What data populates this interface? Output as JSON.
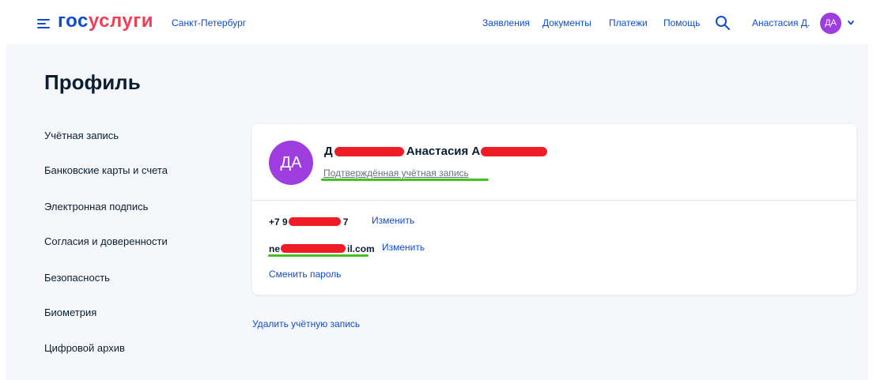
{
  "header": {
    "logo_part1": "гос",
    "logo_part2": "услуги",
    "city": "Санкт-Петербург",
    "nav": [
      "Заявления",
      "Документы",
      "Платежи",
      "Помощь"
    ],
    "user_name": "Анастасия Д.",
    "avatar_initials": "ДА",
    "icons": [
      "menu-icon",
      "search-icon",
      "chevron-down-icon"
    ]
  },
  "page": {
    "title": "Профиль"
  },
  "sidebar": {
    "items": [
      {
        "label": "Учётная запись"
      },
      {
        "label": "Банковские карты и счета"
      },
      {
        "label": "Электронная подпись"
      },
      {
        "label": "Согласия и доверенности"
      },
      {
        "label": "Безопасность"
      },
      {
        "label": "Биометрия"
      },
      {
        "label": "Цифровой архив"
      }
    ]
  },
  "profile": {
    "avatar_initials": "ДА",
    "name_prefix": "Д",
    "name_middle": "Анастасия А",
    "status": "Подтверждённая учётная запись",
    "phone_prefix": "+7 9",
    "phone_suffix": "7",
    "email_prefix": "ne",
    "email_suffix": "il.com",
    "change_label": "Изменить",
    "change_password": "Сменить пароль"
  },
  "delete_account": "Удалить учётную запись",
  "colors": {
    "brand_blue": "#0d4cd3",
    "brand_red": "#ee3f58",
    "avatar_purple": "#9e3de0",
    "redaction_red": "#ee1c25",
    "highlight_green": "#48c020",
    "background": "#f5f7fa"
  }
}
